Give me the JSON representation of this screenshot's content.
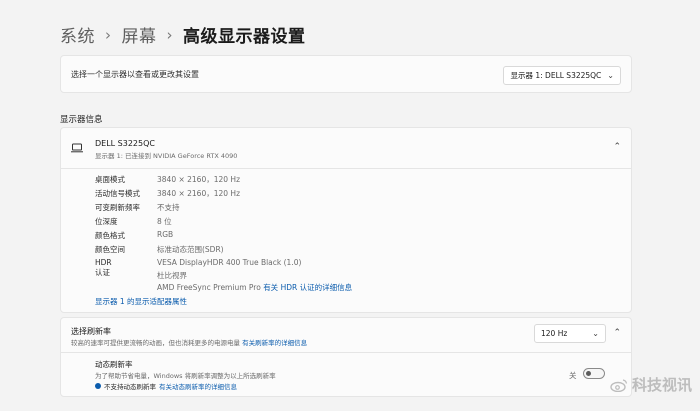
{
  "breadcrumb": {
    "items": [
      "系统",
      "屏幕"
    ],
    "current": "高级显示器设置",
    "separator": "›"
  },
  "monitor_select": {
    "label": "选择一个显示器以查看或更改其设置",
    "value": "显示器 1: DELL S3225QC"
  },
  "display_info": {
    "section_title": "显示器信息",
    "monitor_name": "DELL S3225QC",
    "monitor_subtitle": "显示器 1: 已连接到 NVIDIA GeForce RTX 4090",
    "rows": [
      {
        "key": "桌面模式",
        "value": "3840 × 2160，120 Hz"
      },
      {
        "key": "活动信号模式",
        "value": "3840 × 2160，120 Hz"
      },
      {
        "key": "可变刷新频率",
        "value": "不支持"
      },
      {
        "key": "位深度",
        "value": "8 位"
      },
      {
        "key": "颜色格式",
        "value": "RGB"
      },
      {
        "key": "颜色空间",
        "value": "标准动态范围(SDR)"
      }
    ],
    "hdr": {
      "key": "HDR 认证",
      "line1": "VESA DisplayHDR 400 True Black (1.0)",
      "line2": "杜比视界",
      "line3_text": "AMD FreeSync Premium Pro ",
      "line3_link": "有关 HDR 认证的详细信息"
    },
    "adapter_link": "显示器 1 的显示适配器属性"
  },
  "refresh_rate": {
    "title": "选择刷新率",
    "description": "较高的速率可提供更流畅的动画，但也消耗更多的电源电量",
    "description_link": "有关刷新率的详细信息",
    "value": "120 Hz",
    "dynamic": {
      "title": "动态刷新率",
      "description": "为了帮助节省电量，Windows 将刷新率调整为以上所选刷新率",
      "note_text": "不支持动态刷新率",
      "note_link": "有关动态刷新率的详细信息",
      "toggle_label": "关",
      "toggle_on": false
    }
  },
  "watermark": {
    "text": "科技视讯"
  },
  "colors": {
    "background": "#f3f3f3",
    "card": "#fbfbfb",
    "link": "#0b5cad",
    "muted_text": "#6b6b6b"
  }
}
